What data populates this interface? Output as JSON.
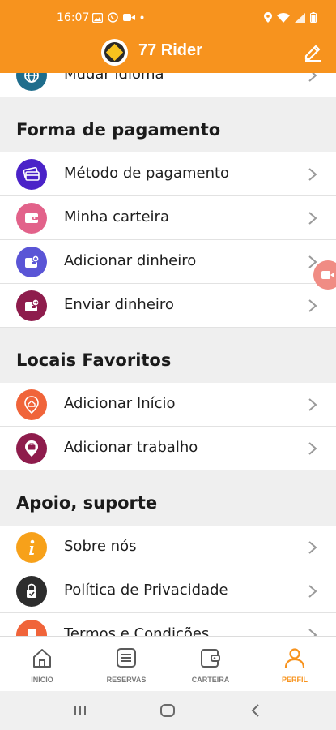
{
  "status_bar": {
    "time": "16:07"
  },
  "app_bar": {
    "title": "77 Rider"
  },
  "list": {
    "partial_top": {
      "label": "Mudar idioma"
    },
    "sections": [
      {
        "title": "Forma de pagamento",
        "items": [
          {
            "label": "Método de pagamento",
            "icon": "card-stack-icon",
            "color": "#4a22c8"
          },
          {
            "label": "Minha carteira",
            "icon": "wallet-icon",
            "color": "#e2628a"
          },
          {
            "label": "Adicionar dinheiro",
            "icon": "wallet-plus-icon",
            "color": "#5a55d6"
          },
          {
            "label": "Enviar dinheiro",
            "icon": "wallet-send-icon",
            "color": "#8e1c4c"
          }
        ]
      },
      {
        "title": "Locais Favoritos",
        "items": [
          {
            "label": "Adicionar Início",
            "icon": "home-pin-icon",
            "color": "#f0643a"
          },
          {
            "label": "Adicionar trabalho",
            "icon": "work-pin-icon",
            "color": "#8e1c4c"
          }
        ]
      },
      {
        "title": "Apoio, suporte",
        "items": [
          {
            "label": "Sobre nós",
            "icon": "info-icon",
            "color": "#f7a11a"
          },
          {
            "label": "Política de Privacidade",
            "icon": "privacy-lock-icon",
            "color": "#2d2d2d"
          },
          {
            "label": "Termos e Condições",
            "icon": "terms-icon",
            "color": "#f0643a"
          }
        ]
      }
    ]
  },
  "bottom_nav": [
    {
      "label": "INÍCIO",
      "icon": "home-icon",
      "active": false
    },
    {
      "label": "RESERVAS",
      "icon": "list-icon",
      "active": false
    },
    {
      "label": "CARTEIRA",
      "icon": "wallet-icon",
      "active": false
    },
    {
      "label": "PERFIL",
      "icon": "user-icon",
      "active": true
    }
  ],
  "colors": {
    "accent": "#f7931e",
    "text": "#1e1e1e",
    "muted": "#7a7a7a",
    "chevron": "#9a9a9a"
  }
}
